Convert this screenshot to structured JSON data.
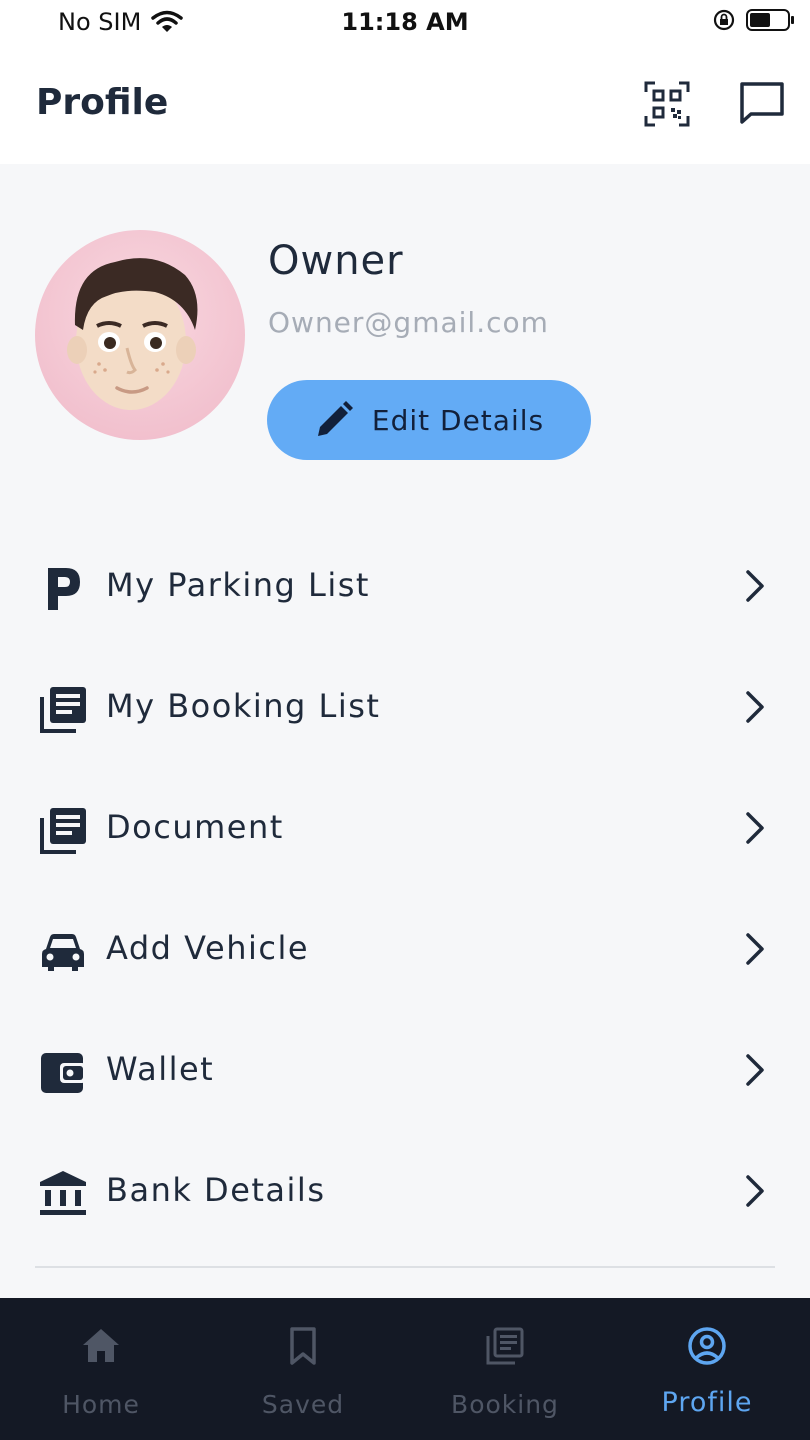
{
  "status_bar": {
    "carrier": "No SIM",
    "time": "11:18 AM"
  },
  "header": {
    "title": "Profile",
    "qr_icon": "qr-code-icon",
    "chat_icon": "chat-icon"
  },
  "profile": {
    "name": "Owner",
    "email": "Owner@gmail.com",
    "edit_label": "Edit Details",
    "avatar_bg": "#f2c2cf"
  },
  "menu": [
    {
      "label": "My Parking List",
      "icon": "parking-icon"
    },
    {
      "label": "My Booking List",
      "icon": "list-icon"
    },
    {
      "label": "Document",
      "icon": "document-icon"
    },
    {
      "label": "Add Vehicle",
      "icon": "car-icon"
    },
    {
      "label": "Wallet",
      "icon": "wallet-icon"
    },
    {
      "label": "Bank Details",
      "icon": "bank-icon"
    }
  ],
  "tabs": [
    {
      "label": "Home",
      "icon": "home-icon",
      "active": false
    },
    {
      "label": "Saved",
      "icon": "bookmark-icon",
      "active": false
    },
    {
      "label": "Booking",
      "icon": "booking-icon",
      "active": false
    },
    {
      "label": "Profile",
      "icon": "profile-icon",
      "active": true
    }
  ],
  "colors": {
    "accent": "#63abf5",
    "active_tab": "#5ea6f1",
    "tabbar_bg": "#141925",
    "text": "#1f2a3b"
  }
}
